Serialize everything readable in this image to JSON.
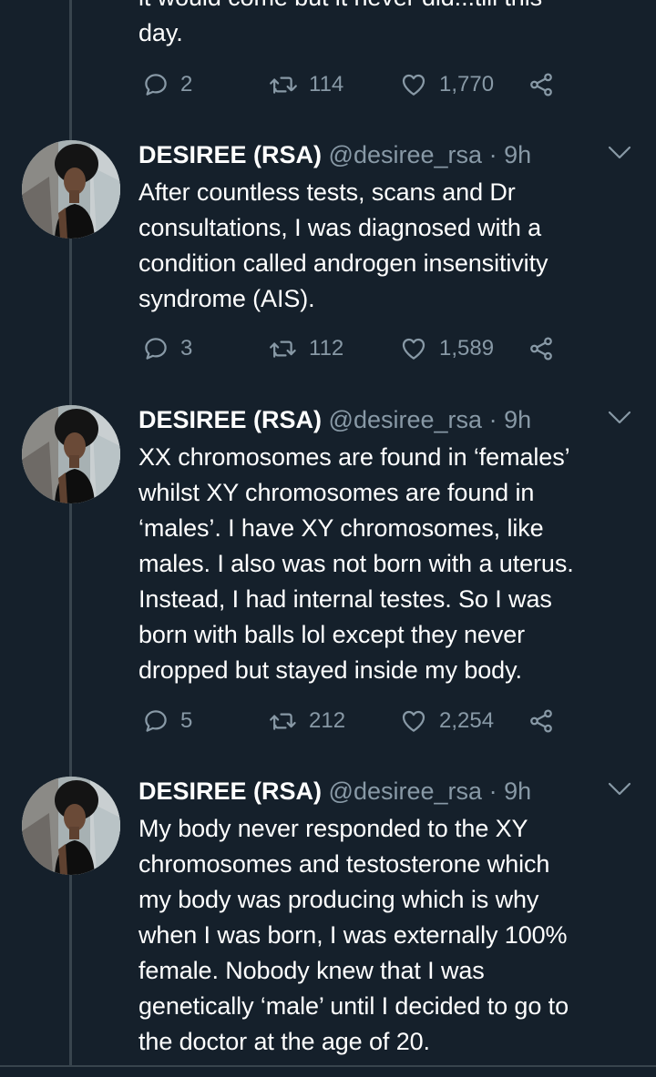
{
  "previous_tweet": {
    "text": "it would come but it never did...till this\nday.",
    "replies": "2",
    "retweets": "114",
    "likes": "1,770"
  },
  "tweets": [
    {
      "name": "DESIREE (RSA)",
      "handle": "@desiree_rsa",
      "separator": "·",
      "time": "9h",
      "text": "After countless tests, scans and Dr\nconsultations, I was diagnosed with a\ncondition called androgen insensitivity\nsyndrome (AIS).",
      "replies": "3",
      "retweets": "112",
      "likes": "1,589"
    },
    {
      "name": "DESIREE (RSA)",
      "handle": "@desiree_rsa",
      "separator": "·",
      "time": "9h",
      "text": "XX chromosomes are found in ‘females’\nwhilst XY chromosomes are found in\n‘males’. I have XY chromosomes, like\nmales. I also was not born with a uterus.\nInstead, I had internal testes. So I was\nborn with balls lol except they never\ndropped but stayed inside my body.",
      "replies": "5",
      "retweets": "212",
      "likes": "2,254"
    },
    {
      "name": "DESIREE (RSA)",
      "handle": "@desiree_rsa",
      "separator": "·",
      "time": "9h",
      "text": "My body never responded to the XY\nchromosomes and testosterone which\nmy body was producing which is why\nwhen I was born, I was externally 100%\nfemale. Nobody knew that I was\ngenetically ‘male’ until I decided to go to\nthe doctor at the age of 20."
    }
  ],
  "icons": {
    "reply": "reply-icon",
    "retweet": "retweet-icon",
    "like": "heart-icon",
    "share": "share-icon",
    "menu": "chevron-down-icon"
  },
  "colors": {
    "background": "#15202b",
    "text": "#ffffff",
    "secondary": "#8899a6",
    "divider": "#38444d"
  }
}
